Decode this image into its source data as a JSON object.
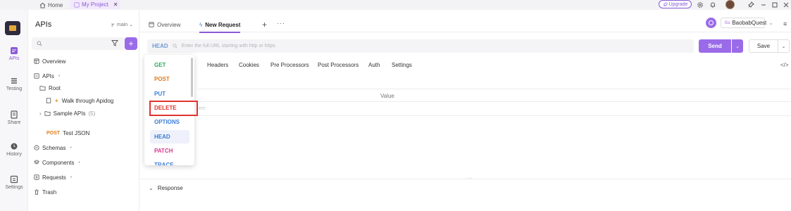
{
  "topbar": {
    "home_label": "Home",
    "project_label": "My Project",
    "close_glyph": "✕",
    "upgrade_label": "Upgrade"
  },
  "rail": {
    "items": [
      {
        "label": "APIs",
        "icon": "apis-icon"
      },
      {
        "label": "Testing",
        "icon": "testing-icon"
      },
      {
        "label": "Share",
        "icon": "share-icon"
      },
      {
        "label": "History",
        "icon": "history-icon"
      },
      {
        "label": "Settings",
        "icon": "settings-icon"
      }
    ]
  },
  "sidebar": {
    "title": "APIs",
    "branch": "main",
    "tree": [
      {
        "label": "Overview",
        "icon": "overview-icon"
      },
      {
        "label": "APIs",
        "icon": "apis-folder-icon",
        "dot": "•"
      },
      {
        "label": "Root",
        "icon": "folder-icon"
      },
      {
        "label": "Walk through Apidog",
        "icon": "doc-icon"
      },
      {
        "label": "Sample APIs",
        "count": "(5)",
        "icon": "folder-icon"
      },
      {
        "label": "Test JSON",
        "method": "POST"
      },
      {
        "label": "Schemas",
        "icon": "schemas-icon",
        "dot": "•"
      },
      {
        "label": "Components",
        "icon": "components-icon",
        "dot": "•"
      },
      {
        "label": "Requests",
        "icon": "requests-icon",
        "dot": "•"
      },
      {
        "label": "Trash",
        "icon": "trash-icon"
      }
    ]
  },
  "tabs": {
    "overview": "Overview",
    "new_request": "New Request",
    "plus": "+",
    "more": "···"
  },
  "environment": {
    "badge": "Ba",
    "name": "BaobabQuest"
  },
  "request": {
    "method": "HEAD",
    "url_placeholder": "Enter the full URL starting with http or https",
    "send_label": "Send",
    "save_label": "Save",
    "tabs": [
      "Headers",
      "Cookies",
      "Pre Processors",
      "Post Processors",
      "Auth",
      "Settings"
    ],
    "code_label": "</>",
    "value_header": "Value",
    "row_placeholder": "em"
  },
  "response": {
    "label": "Response",
    "grip": "···"
  },
  "method_dropdown": {
    "items": [
      {
        "label": "GET",
        "color": "#2bab59"
      },
      {
        "label": "POST",
        "color": "#e07a1a"
      },
      {
        "label": "PUT",
        "color": "#3b7dd8"
      },
      {
        "label": "DELETE",
        "color": "#e0342f"
      },
      {
        "label": "OPTIONS",
        "color": "#3b7dd8"
      },
      {
        "label": "HEAD",
        "color": "#3b7dd8"
      },
      {
        "label": "PATCH",
        "color": "#d6398e"
      },
      {
        "label": "TRACE",
        "color": "#3b7dd8"
      }
    ],
    "selected": "HEAD",
    "highlighted": "DELETE"
  },
  "colors": {
    "accent": "#9a6be8",
    "highlight": "#e0342f"
  }
}
